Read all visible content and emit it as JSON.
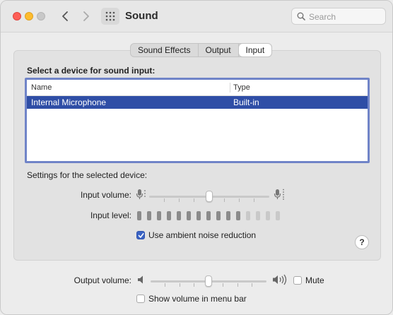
{
  "window": {
    "title": "Sound"
  },
  "search": {
    "placeholder": "Search"
  },
  "tabs": [
    {
      "label": "Sound Effects",
      "active": false
    },
    {
      "label": "Output",
      "active": false
    },
    {
      "label": "Input",
      "active": true
    }
  ],
  "input": {
    "section_label": "Select a device for sound input:",
    "table": {
      "headers": {
        "name": "Name",
        "type": "Type"
      },
      "rows": [
        {
          "name": "Internal Microphone",
          "type": "Built-in",
          "selected": true
        }
      ]
    },
    "settings_label": "Settings for the selected device:",
    "input_volume": {
      "label": "Input volume:",
      "value_fraction": 0.5
    },
    "input_level": {
      "label": "Input level:",
      "lit_bars": 11,
      "total_bars": 15
    },
    "ambient_noise": {
      "label": "Use ambient noise reduction",
      "checked": true
    },
    "help_label": "?"
  },
  "output": {
    "volume_label": "Output volume:",
    "volume_fraction": 0.5,
    "mute_label": "Mute",
    "mute_checked": false,
    "menu_bar_label": "Show volume in menu bar",
    "menu_bar_checked": false
  },
  "colors": {
    "selection": "#2f4ea6",
    "table_focus_ring": "#7084c8",
    "checkbox_on": "#3a63c4"
  },
  "icons": [
    "chevron-left-icon",
    "chevron-right-icon",
    "grid-icon",
    "search-icon",
    "mic-low-icon",
    "mic-high-icon",
    "speaker-low-icon",
    "speaker-high-icon",
    "checkmark-icon"
  ]
}
